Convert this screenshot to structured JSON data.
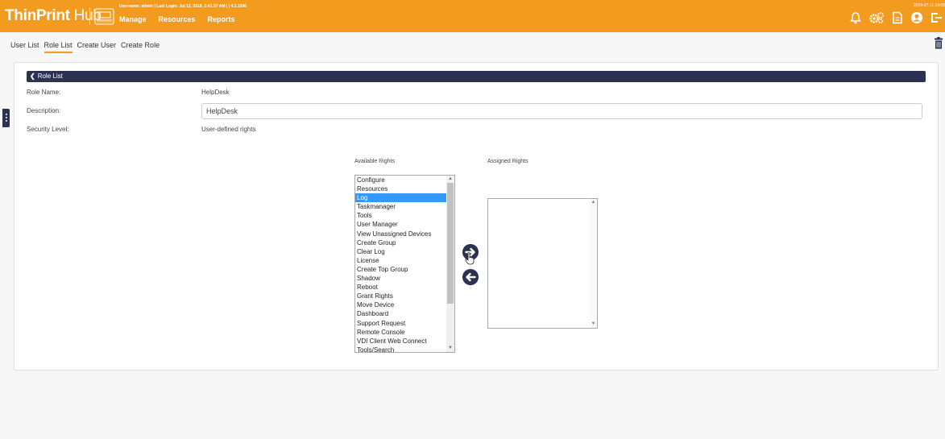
{
  "header": {
    "brand_strong": "ThinPrint",
    "brand_light": " Hub",
    "user_line": "Username: admin | Last Login: Jul 12, 2019, 1:41:37 AM |  |  4.2.1506",
    "datetime": "2019-07-11 19:00",
    "nav": [
      {
        "label": "Manage"
      },
      {
        "label": "Resources"
      },
      {
        "label": "Reports"
      }
    ],
    "accent": "#f39b1e",
    "icons": [
      "bell-icon",
      "gears-icon",
      "document-icon",
      "user-circle-icon",
      "logout-icon"
    ]
  },
  "subnav": {
    "items": [
      {
        "label": "User List"
      },
      {
        "label": "Role List",
        "active": true
      },
      {
        "label": "Create User"
      },
      {
        "label": "Create Role"
      }
    ]
  },
  "panel": {
    "back_label": "Role List",
    "header_color": "#2a3352",
    "fields": {
      "role_name_label": "Role Name:",
      "role_name_value": "HelpDesk",
      "description_label": "Description:",
      "description_value": "HelpDesk",
      "security_label": "Security Level:",
      "security_value": "User-defined rights"
    },
    "available_label": "Available Rights",
    "assigned_label": "Assigned Rights",
    "available_rights": [
      "Configure",
      "Resources",
      "Log",
      "Taskmanager",
      "Tools",
      "User Manager",
      "View Unassigned Devices",
      "Create Group",
      "Clear Log",
      "License",
      "Create Top Group",
      "Shadow",
      "Reboot",
      "Grant Rights",
      "Move Device",
      "Dashboard",
      "Support Request",
      "Remote Console",
      "VDI Client Web Connect",
      "Tools/Search"
    ],
    "selected_right": "Log",
    "assigned_rights": []
  }
}
